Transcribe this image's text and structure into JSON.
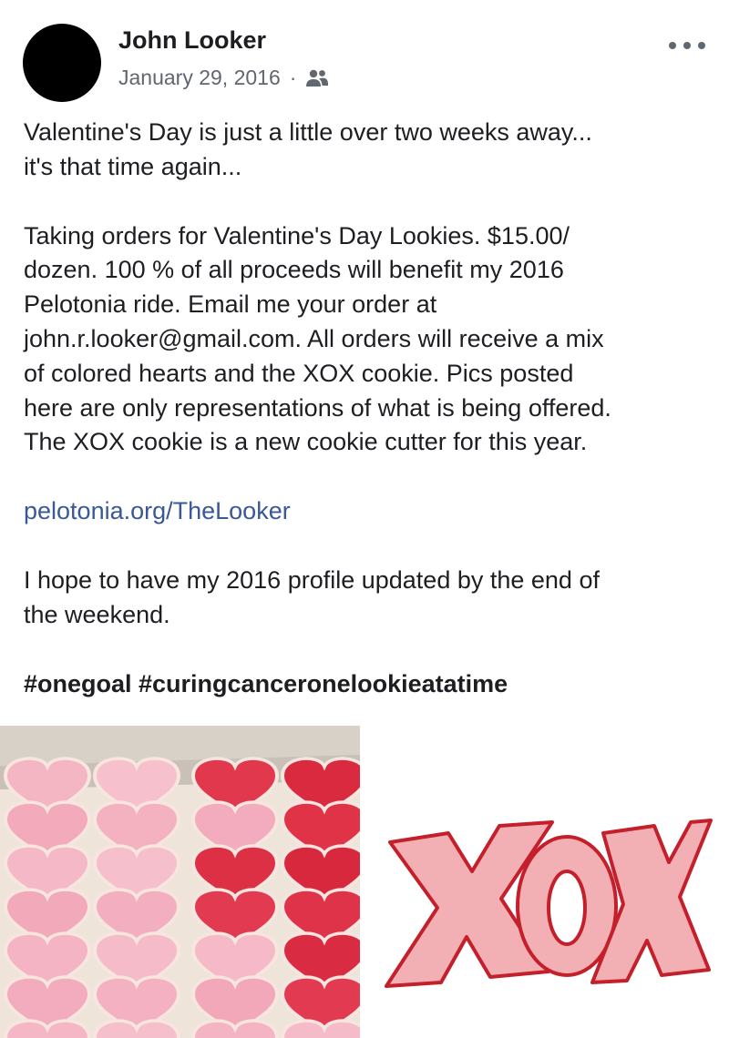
{
  "post": {
    "author": "John Looker",
    "date": "January 29, 2016",
    "separator": "·",
    "audience_icon": "friends-icon",
    "more_icon": "more-options-icon",
    "paragraphs": [
      "Valentine's Day is just a little over two weeks away...\nit's that time again...",
      "Taking orders for Valentine's Day Lookies. $15.00/\ndozen. 100 % of all proceeds will benefit my 2016\nPelotonia ride. Email me your order at\njohn.r.looker@gmail.com.  All orders will receive a mix\nof colored hearts and the XOX cookie. Pics posted\nhere are only representations of what is being offered.\nThe XOX cookie is a new cookie cutter for this year."
    ],
    "link": "pelotonia.org/TheLooker",
    "closing": "I hope to have my 2016 profile updated by the end of\nthe weekend.",
    "hashtags": "#onegoal #curingcanceronelookieatatime"
  },
  "photos": {
    "right_text": "XOX"
  },
  "colors": {
    "link": "#385898",
    "secondary_text": "#606770",
    "cookie_light_pink": "#f3a3b5",
    "cookie_red": "#d8263a"
  }
}
